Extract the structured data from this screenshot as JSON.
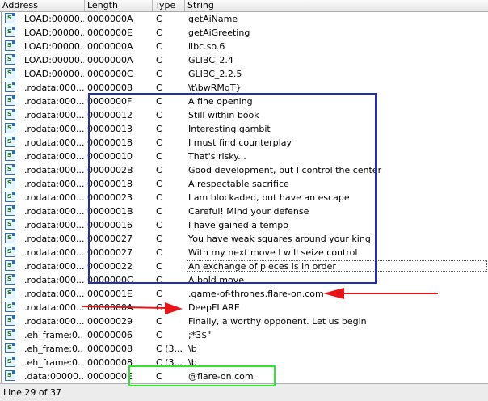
{
  "columns": {
    "address": "Address",
    "length": "Length",
    "type": "Type",
    "string": "String"
  },
  "rows": [
    {
      "address": "LOAD:00000...",
      "length": "0000000A",
      "type": "C",
      "string": "getAiName"
    },
    {
      "address": "LOAD:00000...",
      "length": "0000000E",
      "type": "C",
      "string": "getAiGreeting"
    },
    {
      "address": "LOAD:00000...",
      "length": "0000000A",
      "type": "C",
      "string": "libc.so.6"
    },
    {
      "address": "LOAD:00000...",
      "length": "0000000A",
      "type": "C",
      "string": "GLIBC_2.4"
    },
    {
      "address": "LOAD:00000...",
      "length": "0000000C",
      "type": "C",
      "string": "GLIBC_2.2.5"
    },
    {
      "address": ".rodata:000...",
      "length": "00000008",
      "type": "C",
      "string": "\\t\\bwRMqT}"
    },
    {
      "address": ".rodata:000...",
      "length": "0000000F",
      "type": "C",
      "string": "A fine opening"
    },
    {
      "address": ".rodata:000...",
      "length": "00000012",
      "type": "C",
      "string": "Still within book"
    },
    {
      "address": ".rodata:000...",
      "length": "00000013",
      "type": "C",
      "string": "Interesting gambit"
    },
    {
      "address": ".rodata:000...",
      "length": "00000018",
      "type": "C",
      "string": "I must find counterplay"
    },
    {
      "address": ".rodata:000...",
      "length": "00000010",
      "type": "C",
      "string": "That's risky..."
    },
    {
      "address": ".rodata:000...",
      "length": "0000002B",
      "type": "C",
      "string": "Good development, but I control the center"
    },
    {
      "address": ".rodata:000...",
      "length": "00000018",
      "type": "C",
      "string": "A respectable sacrifice"
    },
    {
      "address": ".rodata:000...",
      "length": "00000023",
      "type": "C",
      "string": "I am blockaded, but have an escape"
    },
    {
      "address": ".rodata:000...",
      "length": "0000001B",
      "type": "C",
      "string": "Careful! Mind your defense"
    },
    {
      "address": ".rodata:000...",
      "length": "00000016",
      "type": "C",
      "string": "I have gained a tempo"
    },
    {
      "address": ".rodata:000...",
      "length": "00000027",
      "type": "C",
      "string": "You have weak squares around your king"
    },
    {
      "address": ".rodata:000...",
      "length": "00000027",
      "type": "C",
      "string": "With my next move I will seize control"
    },
    {
      "address": ".rodata:000...",
      "length": "00000022",
      "type": "C",
      "string": "An exchange of pieces is in order"
    },
    {
      "address": ".rodata:000...",
      "length": "0000000C",
      "type": "C",
      "string": "A bold move"
    },
    {
      "address": ".rodata:000...",
      "length": "0000001E",
      "type": "C",
      "string": ".game-of-thrones.flare-on.com"
    },
    {
      "address": ".rodata:000...",
      "length": "0000000A",
      "type": "C",
      "string": "DeepFLARE"
    },
    {
      "address": ".rodata:000...",
      "length": "00000029",
      "type": "C",
      "string": "Finally, a worthy opponent. Let us begin"
    },
    {
      "address": ".eh_frame:0...",
      "length": "00000006",
      "type": "C",
      "string": ";*3$\""
    },
    {
      "address": ".eh_frame:0...",
      "length": "00000008",
      "type": "C (3...",
      "string": "\\b"
    },
    {
      "address": ".eh_frame:0...",
      "length": "00000008",
      "type": "C (3...",
      "string": "\\b"
    },
    {
      "address": ".data:00000...",
      "length": "0000000E",
      "type": "C",
      "string": "@flare-on.com"
    }
  ],
  "selected_row": 18,
  "status": {
    "text": "Line 29 of 37"
  },
  "colors": {
    "annotation_blue": "#1f2fb0",
    "annotation_red": "#e8141a",
    "annotation_green": "#2ee82e",
    "icon_border": "#2d6fb0"
  },
  "row_icon": "string-s-icon"
}
